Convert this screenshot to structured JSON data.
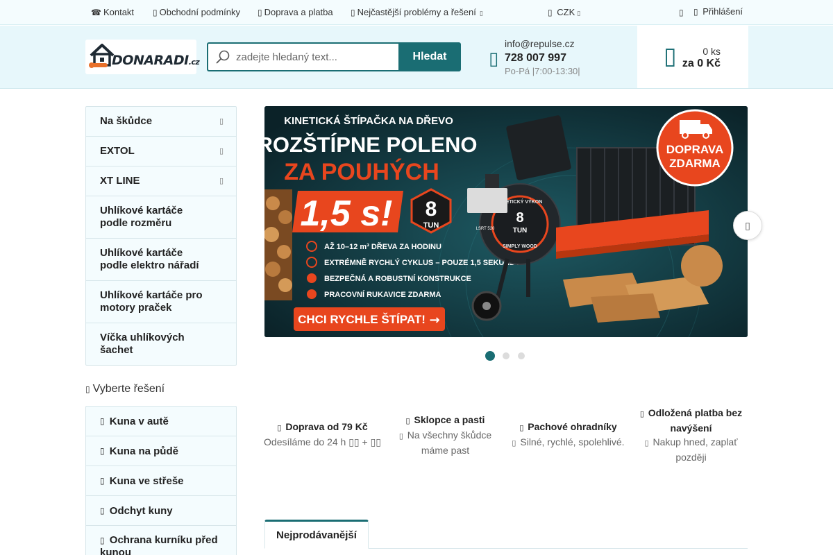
{
  "topbar": {
    "contact": "Kontakt",
    "terms": "Obchodní podmínky",
    "shipping": "Doprava a platba",
    "faq": "Nejčastější problémy a řešení",
    "currency": "CZK",
    "login": "Přihlášení"
  },
  "header": {
    "logo": {
      "do": "DO",
      "naradi": "NARADI",
      "tld": ".cz"
    },
    "search": {
      "placeholder": "zadejte hledaný text...",
      "button": "Hledat"
    },
    "contact": {
      "email": "info@repulse.cz",
      "phone": "728 007 997",
      "hours": "Po-Pá |7:00-13:30|"
    },
    "cart": {
      "count": "0 ks",
      "total": "za 0 Kč"
    }
  },
  "sidebar": {
    "items": [
      {
        "label": "Na škůdce",
        "has_children": true
      },
      {
        "label": "EXTOL",
        "has_children": true
      },
      {
        "label": "XT LINE",
        "has_children": true
      },
      {
        "label": "Uhlíkové kartáče podle rozměru",
        "has_children": false
      },
      {
        "label": "Uhlíkové kartáče podle elektro nářadí",
        "has_children": false
      },
      {
        "label": "Uhlíkové kartáče pro motory praček",
        "has_children": false
      },
      {
        "label": "Víčka uhlíkových šachet",
        "has_children": false
      }
    ]
  },
  "solutions": {
    "title": "Vyberte řešení",
    "items": [
      "Kuna v autě",
      "Kuna na půdě",
      "Kuna ve střeše",
      "Odchyt kuny",
      "Ochrana kurníku před kunou"
    ]
  },
  "banner": {
    "line1": "KINETICKÁ ŠTÍPAČKA NA DŘEVO",
    "line2": "ROZŠTÍPNE POLENO",
    "line3": "ZA POUHÝCH",
    "time": "1,5 s!",
    "tons_value": "8",
    "tons_unit": "TUN",
    "shipping_badge_1": "DOPRAVA",
    "shipping_badge_2": "ZDARMA",
    "features": [
      "AŽ 10–12 m³ DŘEVA ZA HODINU",
      "EXTRÉMNĚ RYCHLÝ CYKLUS – POUZE 1,5 SEKUNDY",
      "BEZPEČNÁ A ROBUSTNÍ KONSTRUKCE",
      "PRACOVNÍ RUKAVICE ZDARMA"
    ],
    "cta": "CHCI RYCHLE ŠTÍPAT!",
    "machine_label_1": "KINETICKÝ VÝKON",
    "machine_label_2": "SIMPLY WOOD",
    "machine_tons": "8",
    "machine_tons_unit": "TUN",
    "model": "LSRT 520"
  },
  "slider": {
    "total": 3,
    "active": 0
  },
  "benefits": [
    {
      "title": "Doprava od 79 Kč",
      "desc": "Odesíláme do 24 h ▯▯ + ▯▯"
    },
    {
      "title": "Sklopce a pasti",
      "desc": "Na všechny škůdce máme past"
    },
    {
      "title": "Pachové ohradníky",
      "desc": "Silné, rychlé, spolehlivé."
    },
    {
      "title": "Odložená platba bez navýšení",
      "desc": "Nakup hned, zaplať později"
    }
  ],
  "tabs": {
    "bestsellers": "Nejprodávanější"
  },
  "colors": {
    "accent": "#1a6d73",
    "header_bg": "#e7f7fb",
    "banner_orange": "#e8461e"
  }
}
